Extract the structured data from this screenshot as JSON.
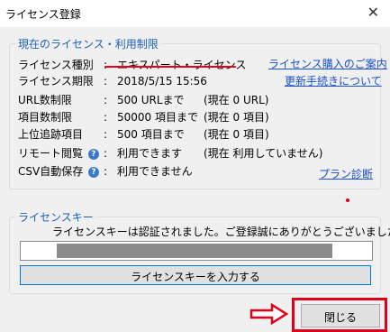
{
  "window": {
    "title": "ライセンス登録",
    "close_glyph": "✕"
  },
  "license_group": {
    "legend": "現在のライセンス・利用制限",
    "rows": [
      {
        "label": "ライセンス種別",
        "colon": ":",
        "value": "エキスパート・ライセンス",
        "extra": ""
      },
      {
        "label": "ライセンス期限",
        "colon": ":",
        "value": "2018/5/15 15:56",
        "extra": ""
      },
      {
        "label": "URL数制限",
        "colon": ":",
        "value": "500 URLまで",
        "extra": "(現在 0 URL)"
      },
      {
        "label": "項目数制限",
        "colon": ":",
        "value": "50000 項目まで",
        "extra": "(現在 0 項目)"
      },
      {
        "label": "上位追跡項目",
        "colon": ":",
        "value": "500 項目まで",
        "extra": "(現在 0 項目)"
      },
      {
        "label": "リモート閲覧",
        "colon": ":",
        "value": "利用できます",
        "extra": "(現在 利用していません)"
      },
      {
        "label": "CSV自動保存",
        "colon": ":",
        "value": "利用できません",
        "extra": ""
      }
    ],
    "help_glyph": "?",
    "links": {
      "purchase": "ライセンス購入のご案内",
      "renewal": "更新手続きについて",
      "plan": "プラン診断"
    }
  },
  "key_group": {
    "legend": "ライセンスキー",
    "message": "ライセンスキーは認証されました。ご登録誠にありがとうございました。",
    "enter_button": "ライセンスキーを入力する"
  },
  "footer": {
    "close_button": "閉じる"
  },
  "colors": {
    "accent": "#1c5fb8",
    "link": "#1a4fcf",
    "annotation": "#e0001a"
  }
}
